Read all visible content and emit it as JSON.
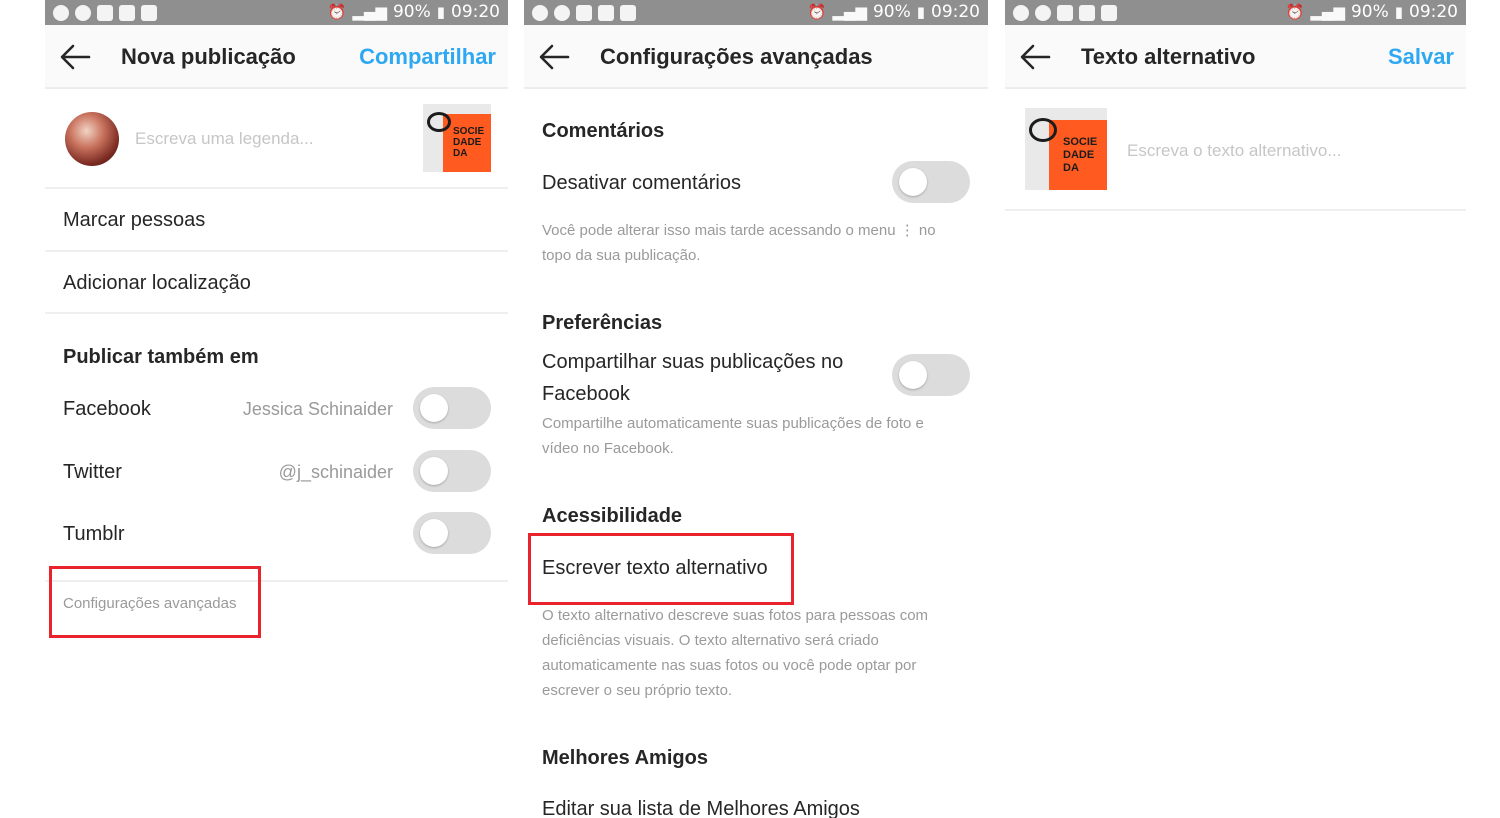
{
  "status_bar": {
    "battery": "90%",
    "time": "09:20"
  },
  "screen1": {
    "title": "Nova publicação",
    "action": "Compartilhar",
    "caption_placeholder": "Escreva uma legenda...",
    "thumbnail_text": [
      "SOCIE",
      "DADE",
      "DA"
    ],
    "tag_people": "Marcar pessoas",
    "add_location": "Adicionar localização",
    "publish_also": "Publicar também em",
    "shares": [
      {
        "network": "Facebook",
        "account": "Jessica Schinaider",
        "enabled": false
      },
      {
        "network": "Twitter",
        "account": "@j_schinaider",
        "enabled": false
      },
      {
        "network": "Tumblr",
        "account": "",
        "enabled": false
      }
    ],
    "advanced": "Configurações avançadas"
  },
  "screen2": {
    "title": "Configurações avançadas",
    "comments_header": "Comentários",
    "disable_comments": "Desativar comentários",
    "comments_desc": "Você pode alterar isso mais tarde acessando o menu ⋮ no topo da sua publicação.",
    "prefs_header": "Preferências",
    "share_fb": "Compartilhar suas publicações no Facebook",
    "share_fb_desc": "Compartilhe automaticamente suas publicações de foto e vídeo no Facebook.",
    "access_header": "Acessibilidade",
    "write_alt": "Escrever texto alternativo",
    "alt_desc": "O texto alternativo descreve suas fotos para pessoas com deficiências visuais. O texto alternativo será criado automaticamente nas suas fotos ou você pode optar por escrever o seu próprio texto.",
    "close_friends_header": "Melhores Amigos",
    "edit_close_friends": "Editar sua lista de Melhores Amigos"
  },
  "screen3": {
    "title": "Texto alternativo",
    "action": "Salvar",
    "alt_placeholder": "Escreva o texto alternativo...",
    "thumbnail_text": [
      "SOCIE",
      "DADE",
      "DA"
    ]
  },
  "colors": {
    "accent": "#2ea8f2",
    "highlight": "#e8232b",
    "statusbar": "#8f8f8f",
    "book": "#ff5a1f"
  }
}
